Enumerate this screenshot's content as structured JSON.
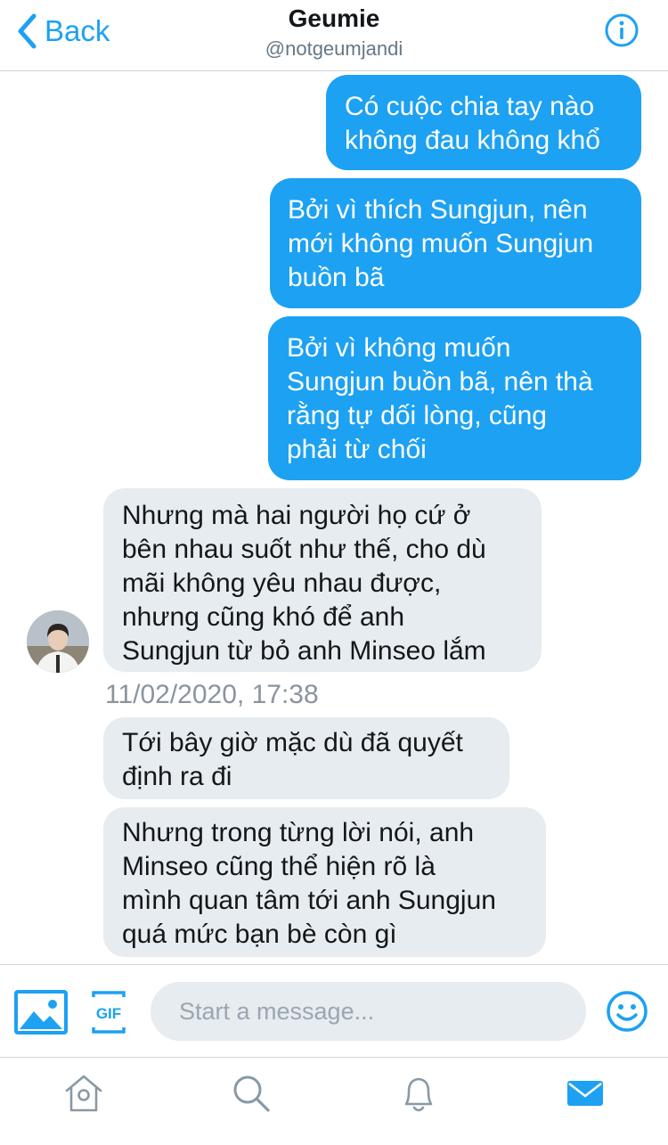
{
  "header": {
    "back_label": "Back",
    "title": "Geumie",
    "handle": "@notgeumjandi"
  },
  "messages": [
    {
      "direction": "outgoing",
      "lines": [
        "Có cuộc chia tay nào",
        "không đau không khổ"
      ]
    },
    {
      "direction": "outgoing",
      "lines": [
        "Bởi vì thích Sungjun, nên",
        "mới không muốn Sungjun",
        "buồn bã"
      ]
    },
    {
      "direction": "outgoing",
      "lines": [
        "Bởi vì không muốn",
        "Sungjun buồn bã, nên thà",
        "rằng tự dối lòng, cũng",
        "phải từ chối"
      ]
    },
    {
      "direction": "incoming",
      "lines": [
        "Nhưng mà hai người họ cứ ở",
        "bên nhau suốt như thế, cho dù",
        "mãi không yêu nhau được,",
        "nhưng cũng khó để anh",
        "Sungjun từ bỏ anh Minseo lắm"
      ]
    },
    {
      "direction": "incoming",
      "lines": [
        "Tới bây giờ mặc dù đã quyết",
        "định ra đi"
      ]
    },
    {
      "direction": "incoming",
      "lines": [
        "Nhưng trong từng lời nói, anh",
        "Minseo cũng thể hiện rõ là",
        "mình quan tâm tới anh Sungjun",
        "quá mức bạn bè còn gì"
      ]
    }
  ],
  "timestamp": "11/02/2020, 17:38",
  "composer": {
    "placeholder": "Start a message...",
    "gif_label": "GIF"
  },
  "icons": {
    "back": "chevron-left-icon",
    "info": "info-icon",
    "media": "image-icon",
    "gif": "gif-icon",
    "emoji": "smiley-icon",
    "tabs": [
      "home-icon",
      "search-icon",
      "bell-icon",
      "mail-icon"
    ]
  },
  "colors": {
    "accent": "#1da1f2",
    "incoming_bubble": "#e6ecf0",
    "muted_text": "#657786"
  }
}
